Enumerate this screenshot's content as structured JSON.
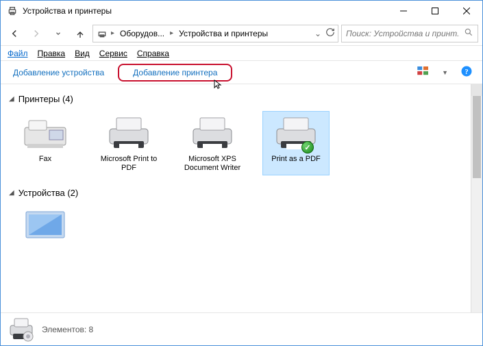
{
  "window": {
    "title": "Устройства и принтеры"
  },
  "titlebar_controls": {
    "min": "—",
    "max": "▢",
    "close": "✕"
  },
  "breadcrumb": [
    "Оборудов...",
    "Устройства и принтеры"
  ],
  "search": {
    "placeholder": "Поиск: Устройства и принт..."
  },
  "menu": {
    "file": "Файл",
    "edit": "Правка",
    "view": "Вид",
    "tools": "Сервис",
    "help": "Справка"
  },
  "toolbar": {
    "add_device": "Добавление устройства",
    "add_printer": "Добавление принтера"
  },
  "groups": {
    "printers": {
      "title": "Принтеры",
      "count": "(4)"
    },
    "devices": {
      "title": "Устройства",
      "count": "(2)"
    }
  },
  "printers": [
    {
      "label": "Fax"
    },
    {
      "label": "Microsoft Print to PDF"
    },
    {
      "label": "Microsoft XPS Document Writer"
    },
    {
      "label": "Print as a PDF",
      "selected": true,
      "default": true
    }
  ],
  "statusbar": {
    "count_label": "Элементов:",
    "count": "8"
  }
}
